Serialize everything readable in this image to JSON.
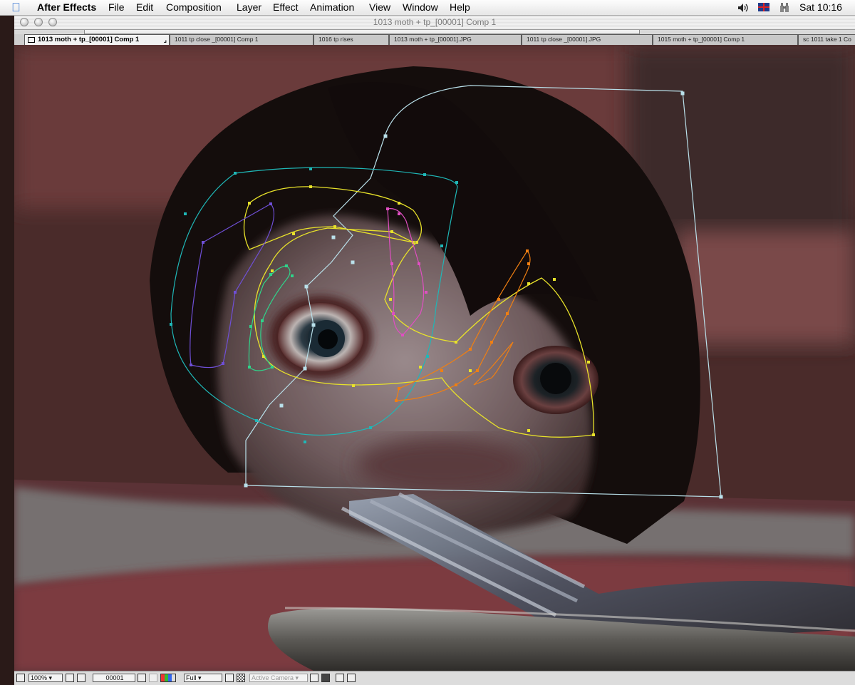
{
  "menubar": {
    "app_name": "After Effects",
    "items": [
      "File",
      "Edit",
      "Composition",
      "Layer",
      "Effect",
      "Animation",
      "View",
      "Window",
      "Help"
    ],
    "clock": "Sat 10:16"
  },
  "window": {
    "title": "1013 moth + tp_[00001] Comp 1"
  },
  "tabs": [
    {
      "label": "1013 moth + tp_[00001] Comp 1",
      "active": true
    },
    {
      "label": "1011 tp close _[00001] Comp 1",
      "active": false
    },
    {
      "label": "1016 tp rises",
      "active": false
    },
    {
      "label": "1013 moth + tp_[00001].JPG",
      "active": false
    },
    {
      "label": "1011 tp close _[00001].JPG",
      "active": false
    },
    {
      "label": "1015 moth + tp_[00001] Comp 1",
      "active": false
    },
    {
      "label": "sc 1011 take 1 Co",
      "active": false
    }
  ],
  "viewer_toolbar": {
    "zoom": "100%",
    "timecode": "00001",
    "resolution": "Full",
    "camera": "Active Camera"
  },
  "mask_colors": {
    "bbox": "#b9e0ea",
    "outer": "#1fb7b7",
    "yellow": "#e8e22a",
    "purple": "#6f4fd6",
    "green": "#2fd48a",
    "pink": "#e04fc2",
    "orange": "#f07f12"
  }
}
